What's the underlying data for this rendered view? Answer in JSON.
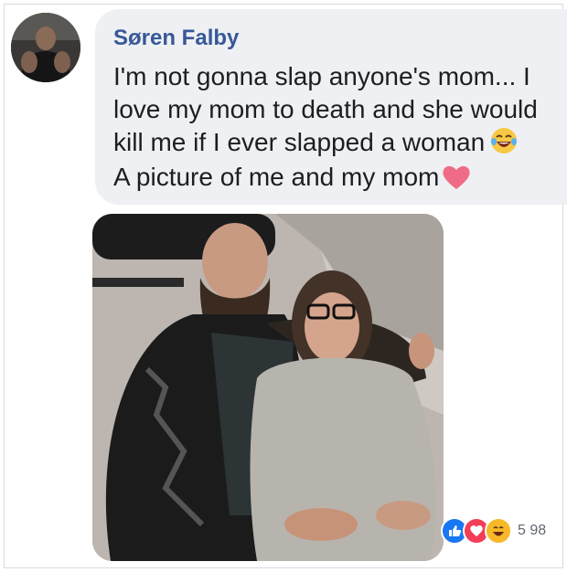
{
  "post": {
    "author": "Søren Falby",
    "message_lines": [
      "I'm not gonna slap anyone's mom... I",
      "love my mom to death and she would",
      "kill me if I ever slapped a woman",
      "A picture of me and my mom"
    ],
    "emoji": {
      "line3": "laughing-tears-icon",
      "line4": "heart-icon"
    }
  },
  "reactions": {
    "icons": [
      "like-icon",
      "love-icon",
      "haha-icon"
    ],
    "count": "5 98"
  },
  "colors": {
    "author": "#385898",
    "bubble": "#eef0f3",
    "like": "#1877f2",
    "love": "#f33e58",
    "haha": "#f7b928"
  }
}
